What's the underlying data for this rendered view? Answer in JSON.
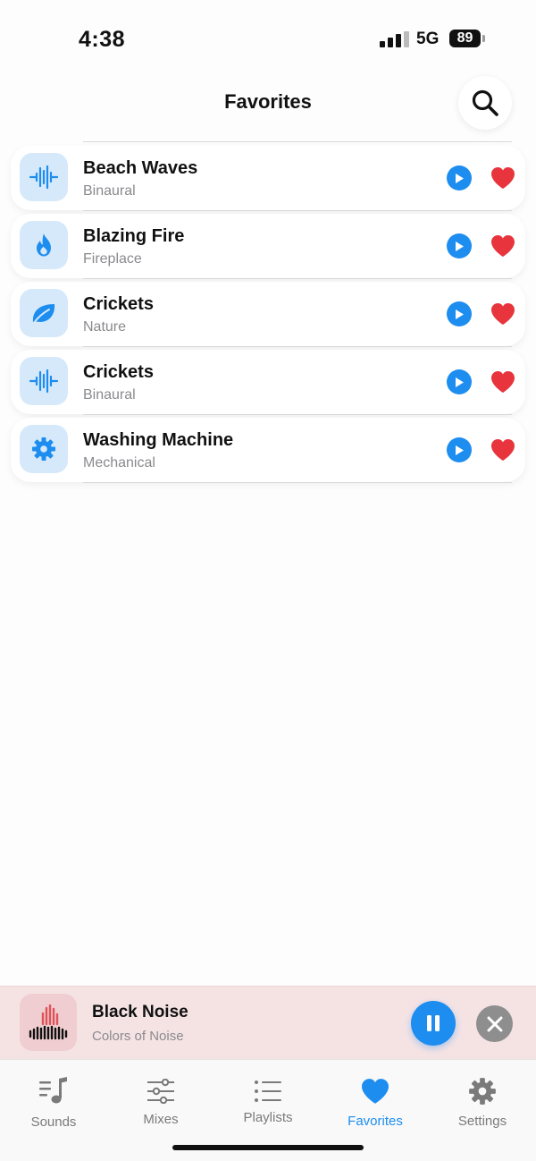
{
  "status_bar": {
    "time": "4:38",
    "network": "5G",
    "battery": "89"
  },
  "header": {
    "title": "Favorites",
    "search_icon": "search-icon"
  },
  "favorites": [
    {
      "title": "Beach Waves",
      "subtitle": "Binaural",
      "icon": "waveform-icon"
    },
    {
      "title": "Blazing Fire",
      "subtitle": "Fireplace",
      "icon": "flame-icon"
    },
    {
      "title": "Crickets",
      "subtitle": "Nature",
      "icon": "leaf-icon"
    },
    {
      "title": "Crickets",
      "subtitle": "Binaural",
      "icon": "waveform-icon"
    },
    {
      "title": "Washing Machine",
      "subtitle": "Mechanical",
      "icon": "gear-icon"
    }
  ],
  "now_playing": {
    "title": "Black Noise",
    "subtitle": "Colors of Noise",
    "icon": "waveform-icon"
  },
  "tabs": [
    {
      "label": "Sounds",
      "icon": "music-note-icon",
      "active": false
    },
    {
      "label": "Mixes",
      "icon": "sliders-icon",
      "active": false
    },
    {
      "label": "Playlists",
      "icon": "list-icon",
      "active": false
    },
    {
      "label": "Favorites",
      "icon": "heart-icon",
      "active": true
    },
    {
      "label": "Settings",
      "icon": "gear-icon",
      "active": false
    }
  ],
  "colors": {
    "accent": "#1d8df0",
    "heart": "#e8343d",
    "icon_bg": "#d6e9fb",
    "now_playing_bg": "#f5e3e4"
  }
}
